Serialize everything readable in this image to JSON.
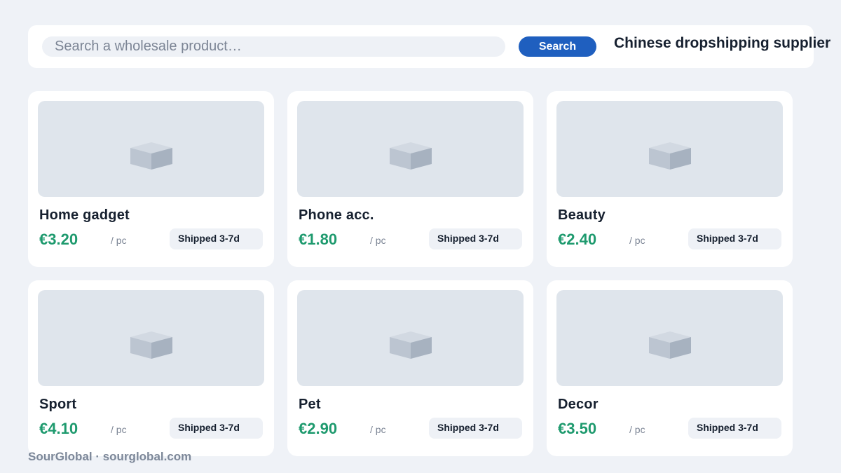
{
  "search": {
    "placeholder": "Search a wholesale product…",
    "button_label": "Search"
  },
  "header": {
    "tagline": "Chinese dropshipping supplier"
  },
  "products": [
    {
      "name": "Home gadget",
      "price": "€3.20",
      "unit": "/ pc",
      "shipping": "Shipped 3-7d",
      "icon": "box-icon"
    },
    {
      "name": "Phone acc.",
      "price": "€1.80",
      "unit": "/ pc",
      "shipping": "Shipped 3-7d",
      "icon": "box-icon"
    },
    {
      "name": "Beauty",
      "price": "€2.40",
      "unit": "/ pc",
      "shipping": "Shipped 3-7d",
      "icon": "box-icon"
    },
    {
      "name": "Sport",
      "price": "€4.10",
      "unit": "/ pc",
      "shipping": "Shipped 3-7d",
      "icon": "box-icon"
    },
    {
      "name": "Pet",
      "price": "€2.90",
      "unit": "/ pc",
      "shipping": "Shipped 3-7d",
      "icon": "box-icon"
    },
    {
      "name": "Decor",
      "price": "€3.50",
      "unit": "/ pc",
      "shipping": "Shipped 3-7d",
      "icon": "box-icon"
    }
  ],
  "footer": {
    "text": "SourGlobal · sourglobal.com"
  },
  "colors": {
    "accent": "#1f5fbf",
    "price": "#1e9a6e",
    "background": "#eff2f7"
  }
}
